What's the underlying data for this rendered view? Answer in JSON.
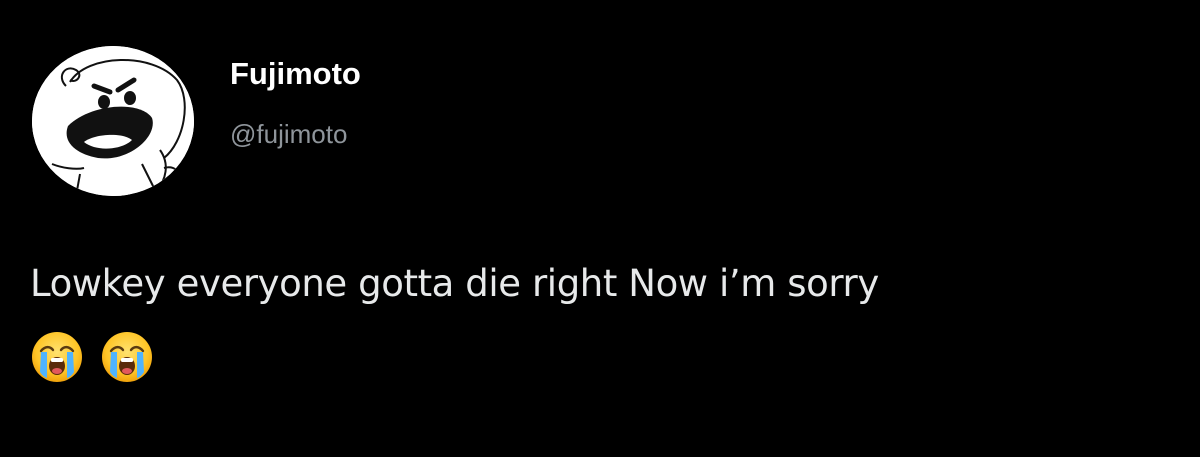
{
  "tweet": {
    "author": {
      "display_name": "Fujimoto",
      "handle": "@fujimoto",
      "avatar_icon": "cartoon-laughing-face-avatar"
    },
    "text": "Lowkey everyone gotta die right Now i’m sorry",
    "emojis": [
      {
        "icon": "loudly-crying-face-icon"
      },
      {
        "icon": "loudly-crying-face-icon"
      }
    ]
  },
  "colors": {
    "background": "#000000",
    "display_name": "#ffffff",
    "handle": "#8f959b",
    "text": "#e7e9ea"
  }
}
